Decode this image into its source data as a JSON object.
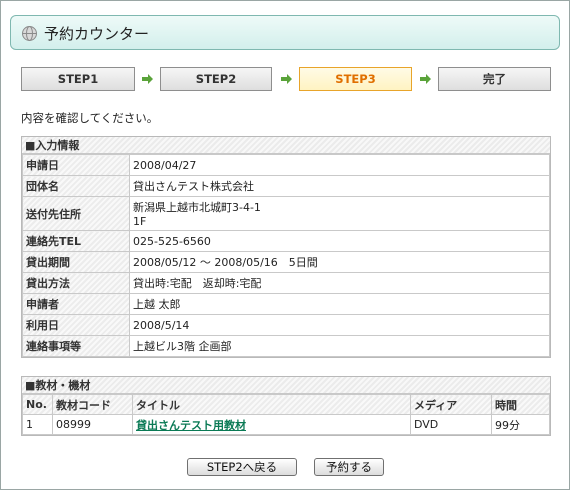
{
  "header": {
    "title": "予約カウンター",
    "icon": "globe-icon"
  },
  "steps": [
    {
      "label": "STEP1",
      "active": false
    },
    {
      "label": "STEP2",
      "active": false
    },
    {
      "label": "STEP3",
      "active": true
    },
    {
      "label": "完了",
      "active": false
    }
  ],
  "intro": "内容を確認してください。",
  "input_info": {
    "heading": "■入力情報",
    "rows": [
      {
        "label": "申請日",
        "value": "2008/04/27"
      },
      {
        "label": "団体名",
        "value": "貸出さんテスト株式会社"
      },
      {
        "label": "送付先住所",
        "value": "新潟県上越市北城町3-4-1",
        "value2": "1F"
      },
      {
        "label": "連絡先TEL",
        "value": "025-525-6560"
      },
      {
        "label": "貸出期間",
        "value": "2008/05/12 〜 2008/05/16　5日間"
      },
      {
        "label": "貸出方法",
        "value": "貸出時:宅配　返却時:宅配"
      },
      {
        "label": "申請者",
        "value": "上越 太郎"
      },
      {
        "label": "利用日",
        "value": "2008/5/14"
      },
      {
        "label": "連絡事項等",
        "value": "上越ビル3階 企画部"
      }
    ]
  },
  "materials": {
    "heading": "■教材・機材",
    "columns": [
      "No.",
      "教材コード",
      "タイトル",
      "メディア",
      "時間"
    ],
    "rows": [
      {
        "no": "1",
        "code": "08999",
        "title": "貸出さんテスト用教材",
        "media": "DVD",
        "time": "99分"
      }
    ]
  },
  "buttons": {
    "back": "STEP2へ戻る",
    "submit": "予約する"
  },
  "colors": {
    "accent": "#e06f00",
    "link": "#0a7a55",
    "arrow": "#5aa33a"
  }
}
